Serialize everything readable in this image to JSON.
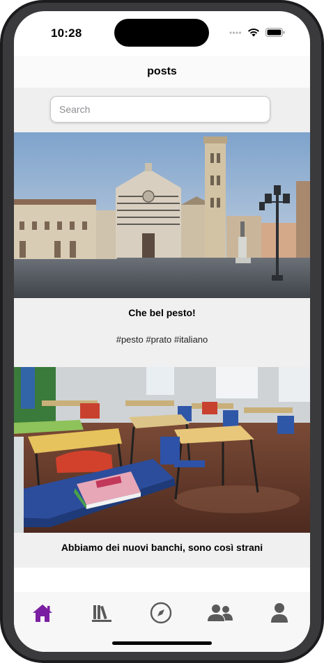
{
  "status_bar": {
    "time": "10:28"
  },
  "header": {
    "title": "posts"
  },
  "search": {
    "placeholder": "Search",
    "value": ""
  },
  "posts": [
    {
      "image_icon": "cathedral-photo",
      "caption": "Che bel pesto!",
      "tags": "#pesto #prato #italiano"
    },
    {
      "image_icon": "classroom-photo",
      "caption": "Abbiamo dei nuovi banchi, sono così strani"
    }
  ],
  "tab_bar": {
    "tabs": [
      {
        "icon": "home-icon",
        "active": true
      },
      {
        "icon": "library-icon",
        "active": false
      },
      {
        "icon": "compass-icon",
        "active": false
      },
      {
        "icon": "users-icon",
        "active": false
      },
      {
        "icon": "profile-icon",
        "active": false
      }
    ]
  },
  "colors": {
    "accent": "#7b1fa2",
    "tab_inactive": "#5a5a5a",
    "post_background": "#f0f0f0"
  }
}
